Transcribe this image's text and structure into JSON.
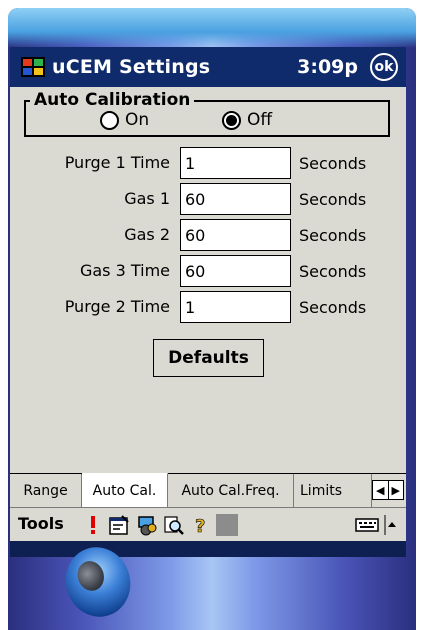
{
  "titlebar": {
    "title": "uCEM Settings",
    "clock": "3:09p",
    "ok_label": "ok",
    "start_icon": "windows-flag-icon"
  },
  "auto_calibration": {
    "legend": "Auto Calibration",
    "options": [
      {
        "label": "On",
        "selected": false
      },
      {
        "label": "Off",
        "selected": true
      }
    ]
  },
  "fields": [
    {
      "label": "Purge 1 Time",
      "value": "1",
      "unit": "Seconds"
    },
    {
      "label": "Gas 1",
      "value": "60",
      "unit": "Seconds"
    },
    {
      "label": "Gas 2",
      "value": "60",
      "unit": "Seconds"
    },
    {
      "label": "Gas 3 Time",
      "value": "60",
      "unit": "Seconds"
    },
    {
      "label": "Purge 2 Time",
      "value": "1",
      "unit": "Seconds"
    }
  ],
  "defaults_button": "Defaults",
  "tabs": [
    {
      "label": "Range",
      "active": false
    },
    {
      "label": "Auto Cal.",
      "active": true
    },
    {
      "label": "Auto Cal.Freq.",
      "active": false
    },
    {
      "label": "Limits",
      "active": false
    }
  ],
  "tab_scroll": {
    "left_icon": "arrow-left-icon",
    "right_icon": "arrow-right-icon"
  },
  "menubar": {
    "tools_label": "Tools",
    "icons": [
      "exclamation-icon",
      "properties-icon",
      "network-icon",
      "search-icon",
      "help-icon",
      "square-icon"
    ],
    "keyboard_icon": "keyboard-icon",
    "sip_arrow_icon": "up-arrow-icon"
  },
  "colors": {
    "titlebar_bg": "#102b6b",
    "content_bg": "#dbdad2",
    "accent_red": "#e00000"
  }
}
